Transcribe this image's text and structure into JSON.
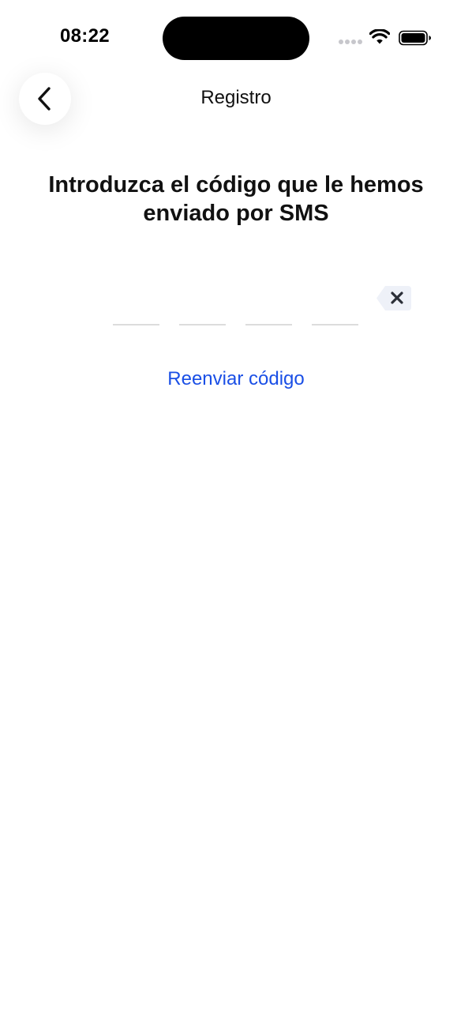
{
  "status_bar": {
    "time": "08:22",
    "signal_icon": "cellular-signal-icon",
    "wifi_icon": "wifi-icon",
    "battery_icon": "battery-icon"
  },
  "nav": {
    "back_icon": "chevron-left-icon",
    "title": "Registro"
  },
  "main": {
    "heading": "Introduzca el código que le hemos enviado por SMS",
    "code_slots": [
      "",
      "",
      "",
      ""
    ],
    "clear_icon": "backspace-clear-icon",
    "resend_label": "Reenviar código"
  },
  "colors": {
    "link": "#1a4fe6",
    "text": "#111111",
    "clear_bg": "#eef1f8",
    "slot_underline": "#dcdcdc"
  }
}
